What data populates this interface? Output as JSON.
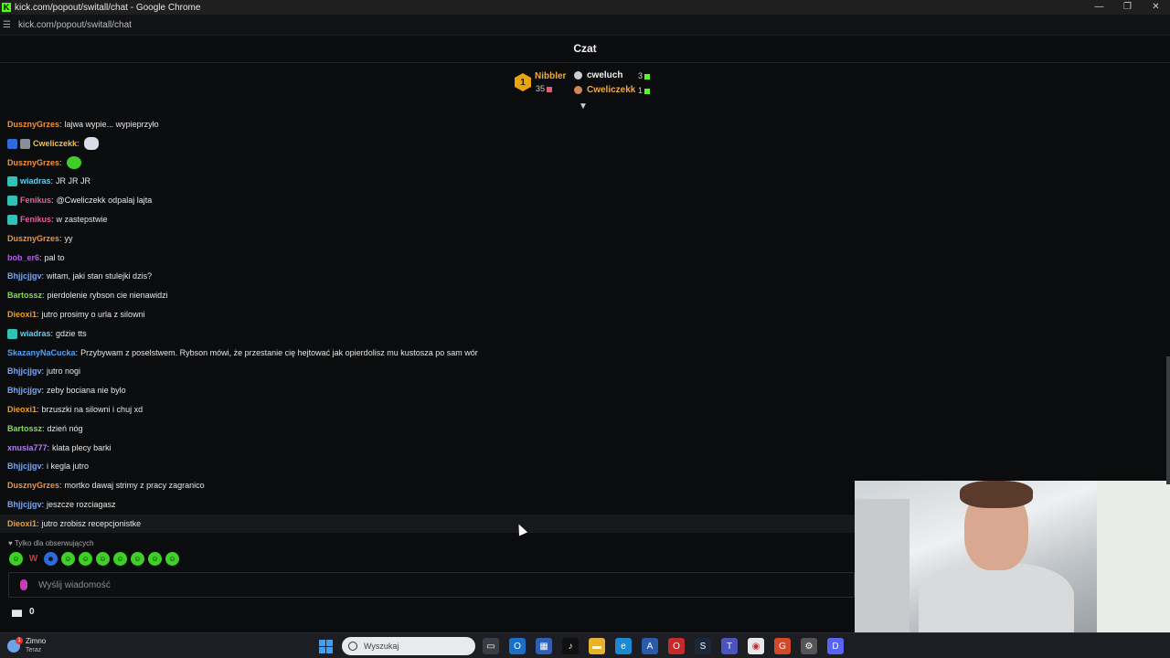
{
  "window": {
    "title": "kick.com/popout/switall/chat - Google Chrome",
    "url": "kick.com/popout/switall/chat",
    "controls": [
      "—",
      "❐",
      "✕"
    ]
  },
  "chat_header": {
    "title": "Czat"
  },
  "leaderboard": {
    "first": {
      "rank": "1",
      "name": "Nibbler",
      "count": "35"
    },
    "second": {
      "name": "cweluch",
      "count": "3"
    },
    "third": {
      "name": "Cweliczekk",
      "count": "1"
    }
  },
  "messages": [
    {
      "user": "DusznyGrzes",
      "color": "#f0943a",
      "text": "lajwa wypie... wypieprzyło",
      "badges": []
    },
    {
      "user": "Cweliczekk",
      "color": "#f2c146",
      "text": "",
      "badges": [
        "blue",
        "gray"
      ],
      "emote": "car"
    },
    {
      "user": "DusznyGrzes",
      "color": "#f0943a",
      "text": "",
      "badges": [],
      "emote": "green-face"
    },
    {
      "user": "wiadras",
      "color": "#5fd0f2",
      "text": "JR JR JR",
      "badges": [
        "teal"
      ]
    },
    {
      "user": "Fenikus",
      "color": "#ea5fa0",
      "text": "@Cweliczekk odpalaj lajta",
      "badges": [
        "teal"
      ]
    },
    {
      "user": "Fenikus",
      "color": "#ea5fa0",
      "text": "w zastepstwie",
      "badges": [
        "teal"
      ]
    },
    {
      "user": "DusznyGrzes",
      "color": "#f0943a",
      "text": "yy",
      "badges": []
    },
    {
      "user": "bob_er6",
      "color": "#b05ff0",
      "text": "pal to",
      "badges": []
    },
    {
      "user": "Bhjjcjjgv",
      "color": "#6fa8ff",
      "text": "witam, jaki stan stulejki dzis?",
      "badges": []
    },
    {
      "user": "Bartossz",
      "color": "#7ee04a",
      "text": "pierdolenie rybson cie nienawidzi",
      "badges": []
    },
    {
      "user": "Dieoxi1",
      "color": "#f0a020",
      "text": "jutro prosimy o urla z silowni",
      "badges": []
    },
    {
      "user": "wiadras",
      "color": "#5fd0f2",
      "text": "gdzie tts",
      "badges": [
        "teal"
      ]
    },
    {
      "user": "SkazanyNaCucka",
      "color": "#4fa3f5",
      "text": "Przybywam z poselstwem. Rybson mówi, że przestanie cię hejtować jak opierdolisz mu kustosza po sam wór",
      "badges": []
    },
    {
      "user": "Bhjjcjjgv",
      "color": "#6fa8ff",
      "text": "jutro nogi",
      "badges": []
    },
    {
      "user": "Bhjjcjjgv",
      "color": "#6fa8ff",
      "text": "zeby bociana nie bylo",
      "badges": []
    },
    {
      "user": "Dieoxi1",
      "color": "#f0a020",
      "text": "brzuszki na silowni i chuj xd",
      "badges": []
    },
    {
      "user": "Bartossz",
      "color": "#7ee04a",
      "text": "dzień nóg",
      "badges": []
    },
    {
      "user": "xnusia777",
      "color": "#b07ff0",
      "text": "klata plecy barki",
      "badges": []
    },
    {
      "user": "Bhjjcjjgv",
      "color": "#6fa8ff",
      "text": "i kegla jutro",
      "badges": []
    },
    {
      "user": "DusznyGrzes",
      "color": "#f0943a",
      "text": "mortko dawaj strimy z pracy zagranico",
      "badges": []
    },
    {
      "user": "Bhjjcjjgv",
      "color": "#6fa8ff",
      "text": "jeszcze rozciagasz",
      "badges": []
    },
    {
      "user": "Dieoxi1",
      "color": "#f0a020",
      "text": "jutro zrobisz recepcjonistke",
      "badges": []
    }
  ],
  "input": {
    "followers_only": "Tylko dla obserwujących",
    "placeholder": "Wyślij wiadomość",
    "gift_count": "0"
  },
  "taskbar": {
    "weather_title": "Zimno",
    "weather_sub": "Teraz",
    "search_placeholder": "Wyszukaj"
  }
}
